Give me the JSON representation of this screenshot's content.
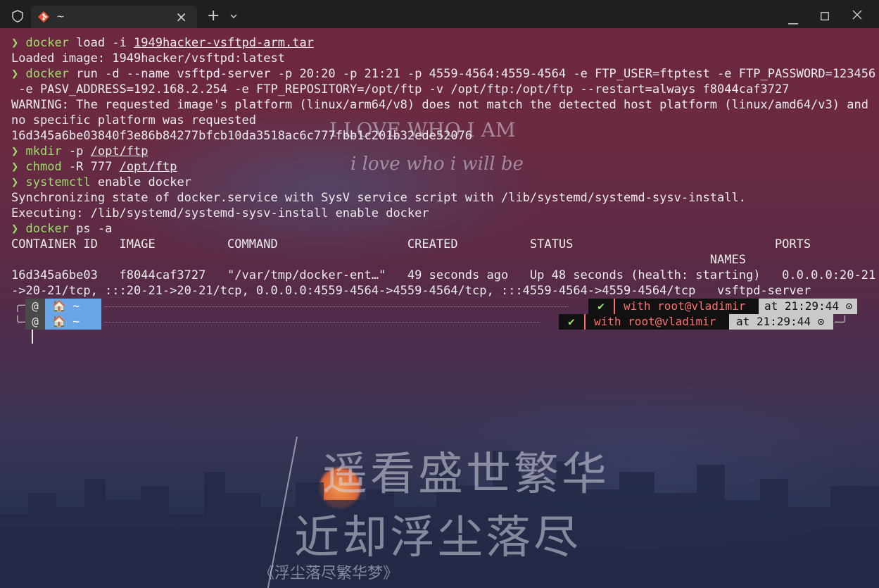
{
  "window": {
    "tab_title": "~",
    "icons": [
      "shield-icon",
      "terminal-app-icon",
      "close-icon",
      "plus-icon",
      "chevron-down-icon",
      "minimize-icon",
      "maximize-icon",
      "window-close-icon"
    ]
  },
  "wallpaper": {
    "heading": "I LOVE WHO I AM",
    "subheading": "i love who i will be",
    "poem_line1": "遥看盛世繁华",
    "poem_line2": "近却浮尘落尽",
    "caption": "《浮尘落尽繁华梦》"
  },
  "terminal": {
    "prompt_symbol": "❯",
    "l1": {
      "cmd": "docker",
      "a": " load -i ",
      "u": "1949hacker-vsftpd-arm.tar"
    },
    "l2": "Loaded image: 1949hacker/vsftpd:latest",
    "l3": {
      "cmd": "docker",
      "a": " run -d --name vsftpd-server -p 20:20 -p 21:21 -p 4559-4564:4559-4564 -e FTP_USER=ftptest -e FTP_PASSWORD=123456"
    },
    "l4": " -e PASV_ADDRESS=192.168.2.254 -e FTP_REPOSITORY=/opt/ftp -v /opt/ftp:/opt/ftp --restart=always f8044caf3727",
    "l5": "WARNING: The requested image's platform (linux/arm64/v8) does not match the detected host platform (linux/amd64/v3) and",
    "l6": "no specific platform was requested",
    "l7": "16d345a6be03840f3e86b84277bfcb10da3518ac6c777fbb1c201b32ede52076",
    "l8": {
      "cmd": "mkdir",
      "a": " -p ",
      "u": "/opt/ftp"
    },
    "l9": {
      "cmd": "chmod",
      "a": " -R 777 ",
      "u": "/opt/ftp"
    },
    "l10": {
      "cmd": "systemctl",
      "a": " enable docker"
    },
    "l11": "Synchronizing state of docker.service with SysV service script with /lib/systemd/systemd-sysv-install.",
    "l12": "Executing: /lib/systemd/systemd-sysv-install enable docker",
    "l13": {
      "cmd": "docker",
      "a": " ps -a"
    },
    "l14": "CONTAINER ID   IMAGE          COMMAND                  CREATED          STATUS                            PORTS",
    "l15": "                                                                                                 NAMES",
    "l16": "16d345a6be03   f8044caf3727   \"/var/tmp/docker-ent…\"   49 seconds ago   Up 48 seconds (health: starting)   0.0.0.0:20-21",
    "l17": "->20-21/tcp, :::20-21->20-21/tcp, 0.0.0.0:4559-4564->4559-4564/tcp, :::4559-4564->4559-4564/tcp   vsftpd-server"
  },
  "prompt_bar": {
    "os_glyph": "@",
    "home": "🏠 ~",
    "ok": "✔",
    "user_prefix": "with ",
    "user": "root@vladimir",
    "time": "at 21:29:44",
    "clock_icon": "⊙"
  },
  "colors": {
    "prompt_green": "#9adf6a",
    "home_segment": "#6aa5e6",
    "os_segment": "#4a4a4a",
    "user_text": "#ff6f6f",
    "time_segment": "#c9c9c9"
  }
}
